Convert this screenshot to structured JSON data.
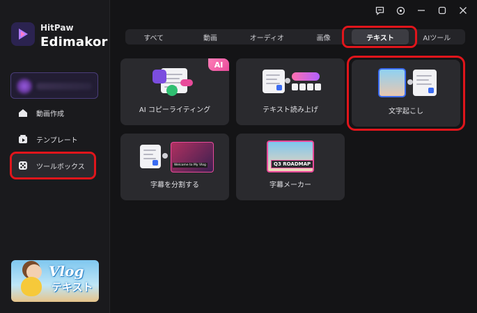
{
  "app": {
    "brand_top": "HitPaw",
    "brand_main": "Edimakor"
  },
  "sidebar": {
    "items": [
      {
        "label": "動画作成",
        "icon": "home-icon"
      },
      {
        "label": "テンプレート",
        "icon": "template-icon"
      },
      {
        "label": "ツールボックス",
        "icon": "toolbox-icon",
        "active": true
      }
    ],
    "promo": {
      "title": "Vlog",
      "subtitle": "テキスト"
    }
  },
  "window_controls": [
    "feedback-icon",
    "settings-icon",
    "minimize-icon",
    "maximize-icon",
    "close-icon"
  ],
  "tabs": [
    {
      "label": "すべて"
    },
    {
      "label": "動画"
    },
    {
      "label": "オーディオ"
    },
    {
      "label": "画像"
    },
    {
      "label": "テキスト",
      "active": true
    },
    {
      "label": "AIツール"
    }
  ],
  "cards": [
    {
      "label": "AI コピーライティング",
      "badge": "AI"
    },
    {
      "label": "テキスト読み上げ"
    },
    {
      "label": "文字起こし"
    },
    {
      "label": "字幕を分割する",
      "thumb_lines": [
        "Welcome to My Vlog"
      ]
    },
    {
      "label": "字幕メーカー",
      "thumb_text": "Q3 ROADMAP"
    }
  ],
  "colors": {
    "highlight": "#e0151b",
    "accent_blue": "#3b6cf2",
    "accent_pink": "#e84a9a",
    "accent_purple": "#7b4ddf"
  }
}
